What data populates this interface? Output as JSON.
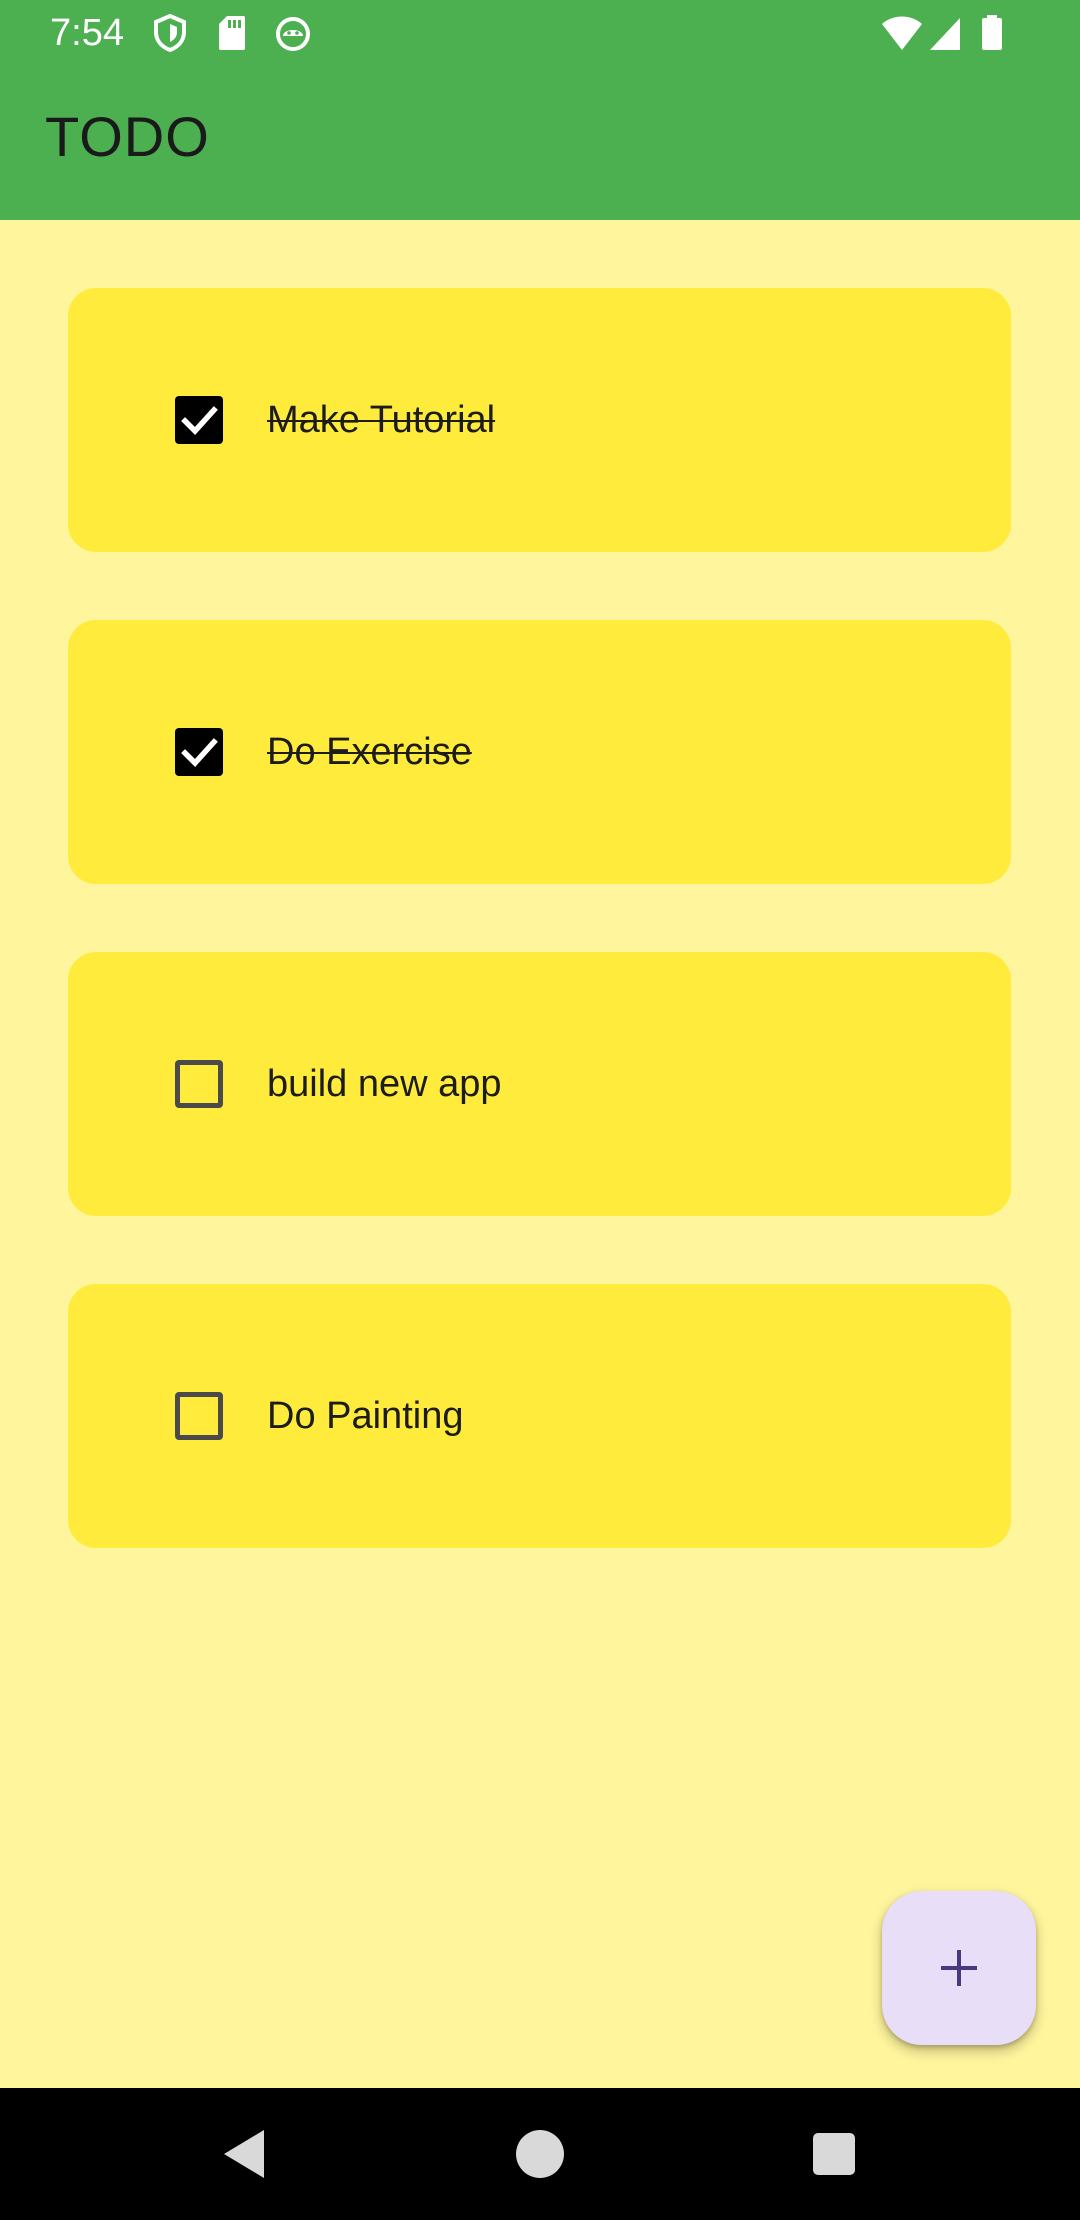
{
  "status_bar": {
    "time": "7:54",
    "left_icons": [
      "shield-icon",
      "sd-card-icon",
      "android-debug-icon"
    ],
    "right_icons": [
      "wifi-icon",
      "cell-signal-icon",
      "battery-icon"
    ]
  },
  "app_bar": {
    "title": "TODO",
    "color": "#4CAF50"
  },
  "todos": [
    {
      "label": "Make Tutorial",
      "checked": true
    },
    {
      "label": "Do Exercise",
      "checked": true
    },
    {
      "label": "build new app",
      "checked": false
    },
    {
      "label": "Do Painting",
      "checked": false
    }
  ],
  "colors": {
    "background": "#FFF59D",
    "card": "#FFEB3B",
    "fab": "#E8DEF8",
    "fab_icon": "#4A3780"
  },
  "fab": {
    "icon": "plus-icon"
  },
  "nav_bar": {
    "buttons": [
      "back-icon",
      "home-icon",
      "recents-icon"
    ]
  }
}
